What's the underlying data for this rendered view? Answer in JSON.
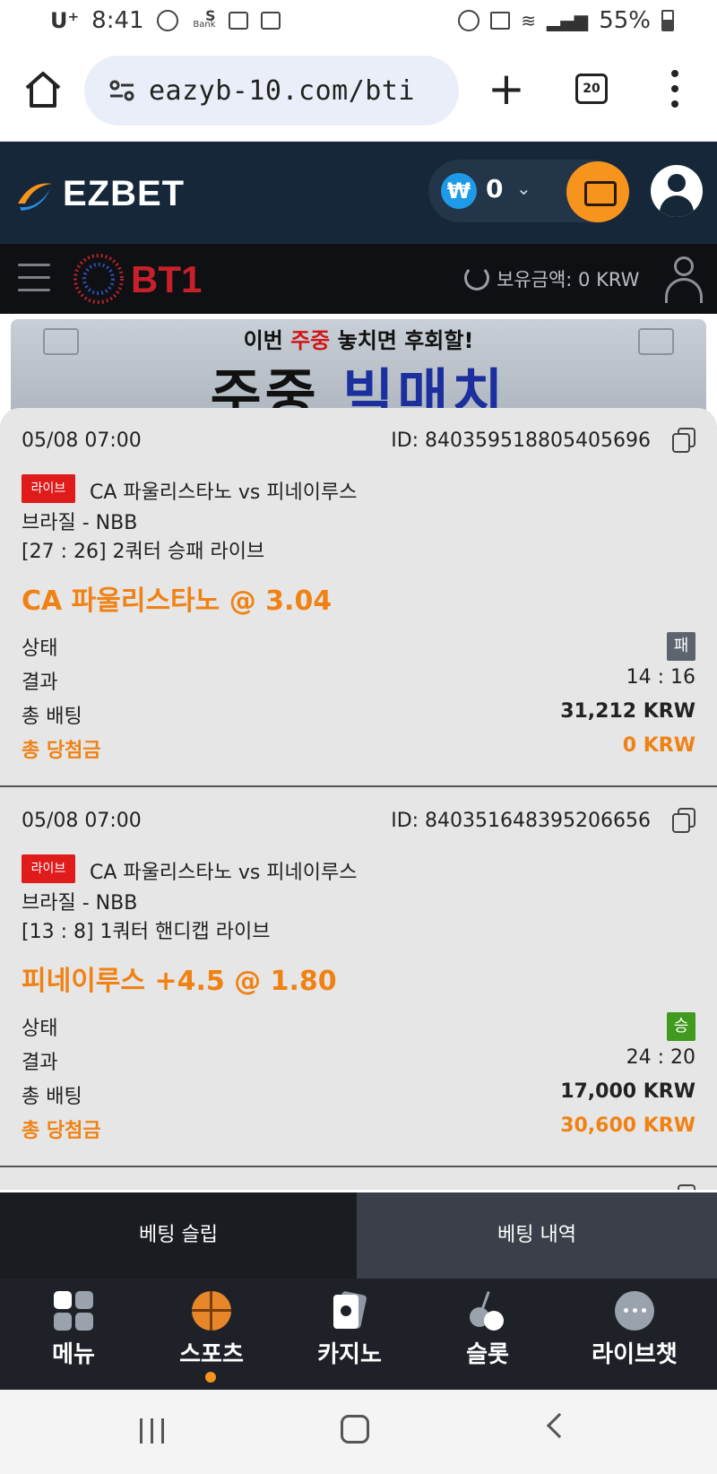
{
  "status_bar": {
    "carrier": "U⁺",
    "time": "8:41",
    "bank_label": "Bank",
    "battery": "55%"
  },
  "browser": {
    "url": "eazyb-10.com/bti",
    "tab_count": "20"
  },
  "header": {
    "logo_text": "EZBET",
    "wallet_currency_symbol": "₩",
    "wallet_amount": "0",
    "accent_color": "#f7941d"
  },
  "bt1_bar": {
    "logo_text": "BT1",
    "balance_label": "보유금액:",
    "balance_value": "0 KRW"
  },
  "banner": {
    "line1_pre": "이번 ",
    "line1_highlight": "주중",
    "line1_post": " 놓치면 후회할!",
    "line2_pre": "주중 ",
    "line2_highlight": "빅매치"
  },
  "bets": [
    {
      "datetime": "05/08 07:00",
      "id": "ID: 840359518805405696",
      "live_label": "라이브",
      "match": "CA 파울리스타노 vs 피네이루스",
      "league": "브라질 - NBB",
      "market": "[27 : 26] 2쿼터 승패 라이브",
      "pick": "CA 파울리스타노 @ 3.04",
      "status_label": "상태",
      "status_value": "패",
      "status_color": "#5d646e",
      "result_label": "결과",
      "result_value": "14 : 16",
      "stake_label": "총 배팅",
      "stake_value": "31,212 KRW",
      "payout_label": "총 당첨금",
      "payout_value": "0 KRW"
    },
    {
      "datetime": "05/08 07:00",
      "id": "ID: 840351648395206656",
      "live_label": "라이브",
      "match": "CA 파울리스타노 vs 피네이루스",
      "league": "브라질 - NBB",
      "market": "[13 : 8] 1쿼터 핸디캡 라이브",
      "pick": "피네이루스 +4.5 @ 1.80",
      "status_label": "상태",
      "status_value": "승",
      "status_color": "#3f9a1f",
      "result_label": "결과",
      "result_value": "24 : 20",
      "stake_label": "총 배팅",
      "stake_value": "17,000 KRW",
      "payout_label": "총 당첨금",
      "payout_value": "30,600 KRW"
    }
  ],
  "slip_tabs": {
    "slip": "베팅 슬립",
    "history": "베팅 내역"
  },
  "bottom_nav": [
    {
      "label": "메뉴",
      "icon": "grid-icon"
    },
    {
      "label": "스포츠",
      "icon": "basketball-icon"
    },
    {
      "label": "카지노",
      "icon": "cards-icon"
    },
    {
      "label": "슬롯",
      "icon": "cherry-icon"
    },
    {
      "label": "라이브챗",
      "icon": "chat-icon"
    }
  ]
}
